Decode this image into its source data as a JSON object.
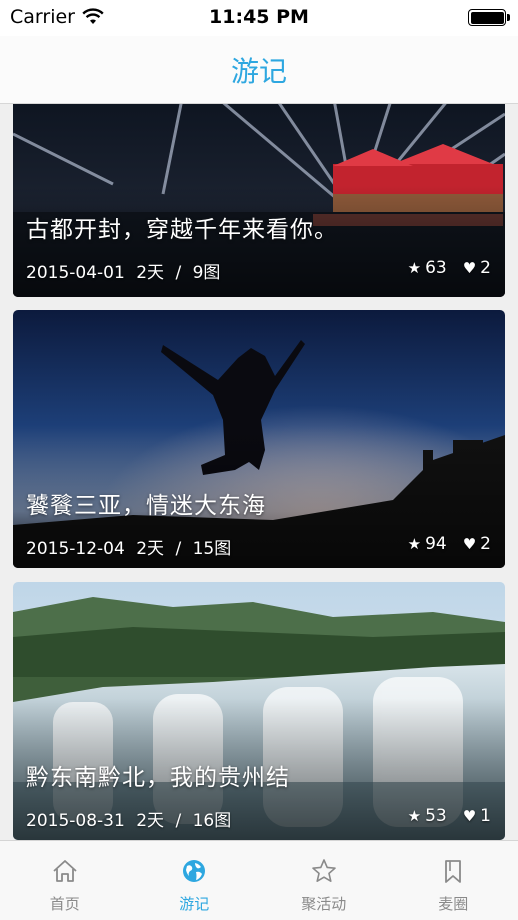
{
  "status_bar": {
    "carrier": "Carrier",
    "time": "11:45 PM"
  },
  "nav": {
    "title": "游记"
  },
  "cards": [
    {
      "title": "古都开封，穿越千年来看你。",
      "date": "2015-04-01",
      "days": "2天",
      "photos": "9图",
      "stars": "63",
      "likes": "2"
    },
    {
      "title": "饕餮三亚，情迷大东海",
      "date": "2015-12-04",
      "days": "2天",
      "photos": "15图",
      "stars": "94",
      "likes": "2"
    },
    {
      "title": "黔东南黔北，我的贵州结",
      "date": "2015-08-31",
      "days": "2天",
      "photos": "16图",
      "stars": "53",
      "likes": "1"
    }
  ],
  "tabs": [
    {
      "label": "首页",
      "icon": "home-icon"
    },
    {
      "label": "游记",
      "icon": "globe-icon"
    },
    {
      "label": "聚活动",
      "icon": "star-outline-icon"
    },
    {
      "label": "麦圈",
      "icon": "bookmark-icon"
    }
  ],
  "colors": {
    "accent": "#2ea7e0",
    "tab_inactive": "#8a8a8a"
  }
}
